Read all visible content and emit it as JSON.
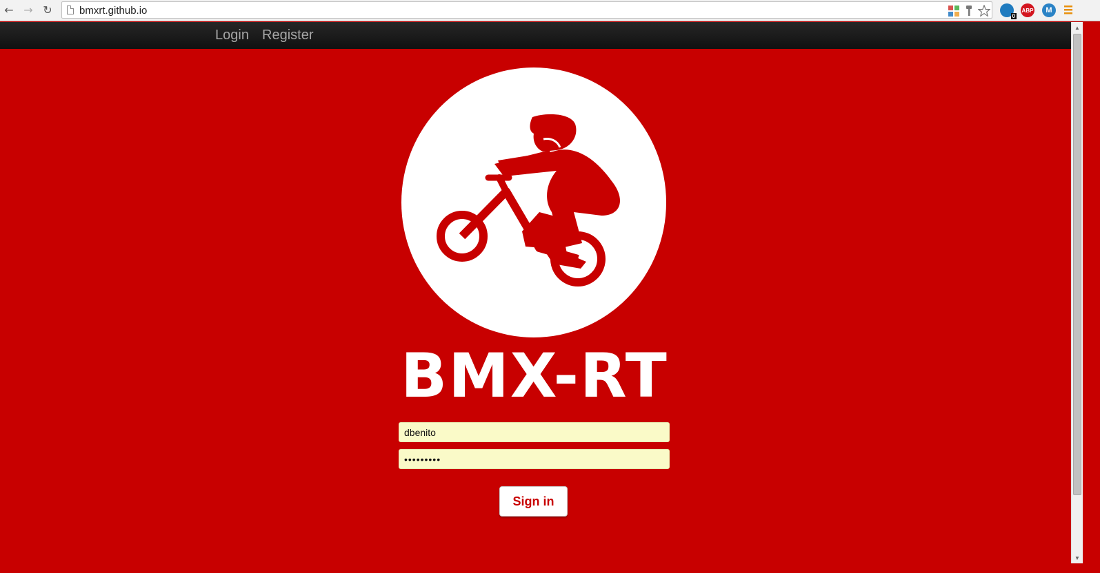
{
  "browser": {
    "url": "bmxrt.github.io",
    "extensions": [
      {
        "name": "avg-icon",
        "color": "#3b8a3b",
        "label": ""
      },
      {
        "name": "ghostery-icon",
        "color": "#1f7bbf",
        "label": "0"
      },
      {
        "name": "adblock-plus-icon",
        "color": "#d3151f",
        "label": "ABP"
      },
      {
        "name": "mercury-icon",
        "color": "#2b83c6",
        "label": "M"
      }
    ]
  },
  "navbar": {
    "login_label": "Login",
    "register_label": "Register"
  },
  "brand": {
    "name": "BMX-RT",
    "accent_color": "#c80000"
  },
  "form": {
    "username_value": "dbenito",
    "password_value": "•••••••••",
    "signin_label": "Sign in"
  }
}
